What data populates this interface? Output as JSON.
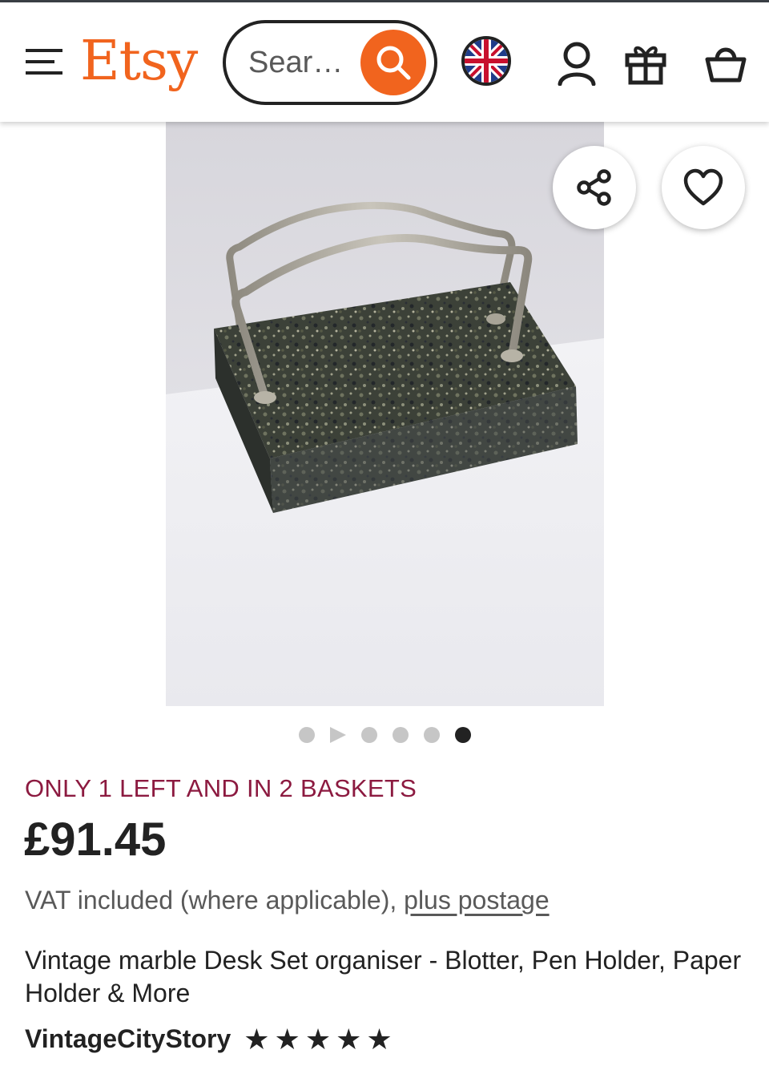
{
  "header": {
    "logo": "Etsy",
    "search_placeholder": "Sear…",
    "icons": [
      "menu-icon",
      "search-icon",
      "uk-flag-icon",
      "account-icon",
      "gift-icon",
      "basket-icon"
    ]
  },
  "listing": {
    "image_actions": [
      "share-icon",
      "favorite-heart-icon"
    ],
    "carousel": {
      "total": 6,
      "active_index": 5,
      "video_index": 1
    },
    "stock_message": "ONLY 1 LEFT AND IN 2 BASKETS",
    "price": "£91.45",
    "vat_text": "VAT included (where applicable), ",
    "postage_link": "plus postage",
    "title": "Vintage marble Desk Set organiser - Blotter, Pen Holder, Paper Holder & More",
    "shop_name": "VintageCityStory",
    "rating_stars": 5
  },
  "colors": {
    "brand": "#f1641e",
    "stock": "#8c1a40",
    "text": "#222222",
    "muted": "#595959"
  }
}
